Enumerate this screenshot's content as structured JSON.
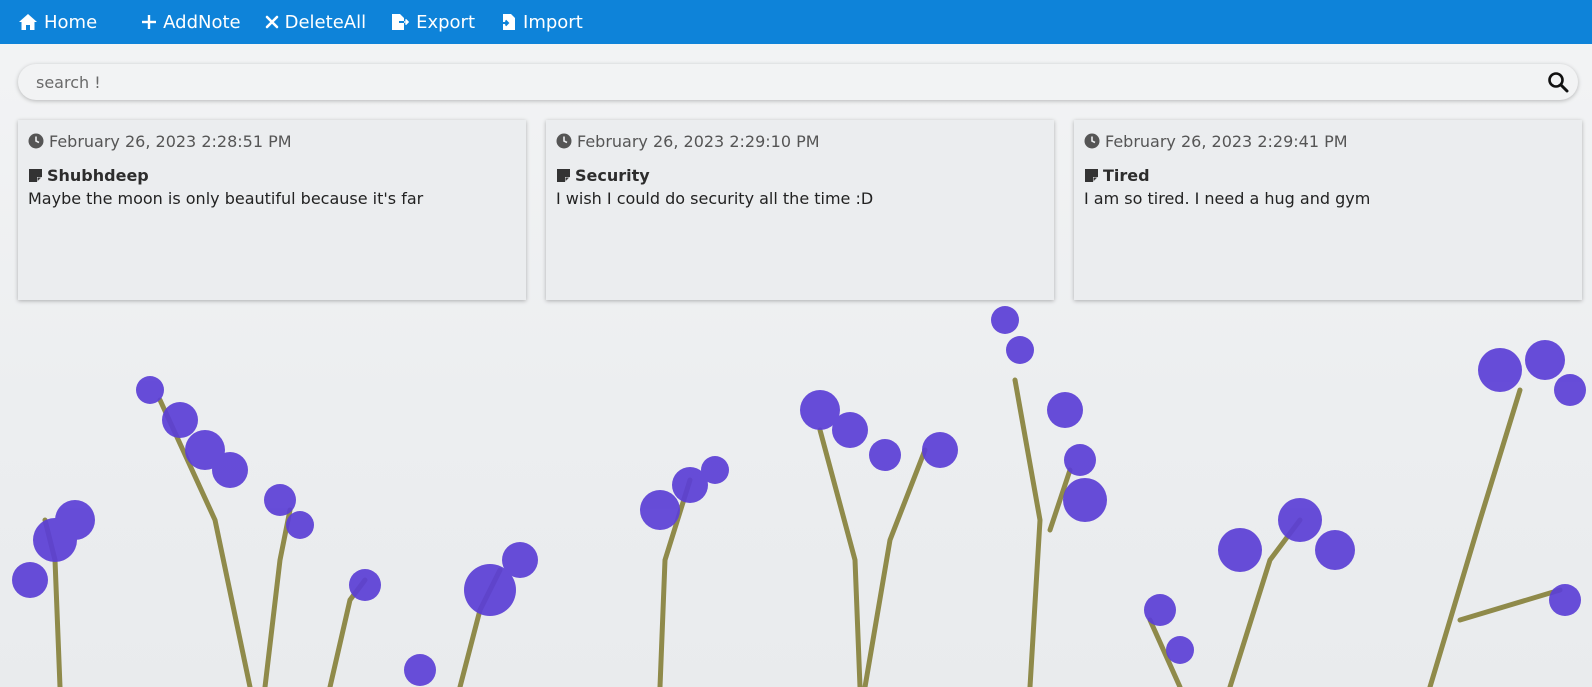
{
  "navbar": {
    "items": [
      {
        "label": "Home",
        "icon": "home-icon"
      },
      {
        "label": "AddNote",
        "icon": "plus-icon"
      },
      {
        "label": "DeleteAll",
        "icon": "x-icon"
      },
      {
        "label": "Export",
        "icon": "export-file-icon"
      },
      {
        "label": "Import",
        "icon": "import-file-icon"
      }
    ],
    "color": "#0e83d9"
  },
  "search": {
    "placeholder": "search !",
    "value": ""
  },
  "notes": [
    {
      "date": "February 26, 2023 2:28:51 PM",
      "title": "Shubhdeep",
      "body": "Maybe the moon is only beautiful because it's far"
    },
    {
      "date": "February 26, 2023 2:29:10 PM",
      "title": "Security",
      "body": "I wish I could do security all the time :D"
    },
    {
      "date": "February 26, 2023 2:29:41 PM",
      "title": "Tired",
      "body": "I am so tired. I need a hug and gym"
    }
  ],
  "background": {
    "image": "purple statice flowers on white background",
    "flower_color": "#5b3fd6",
    "stem_color": "#8f8a4a"
  }
}
